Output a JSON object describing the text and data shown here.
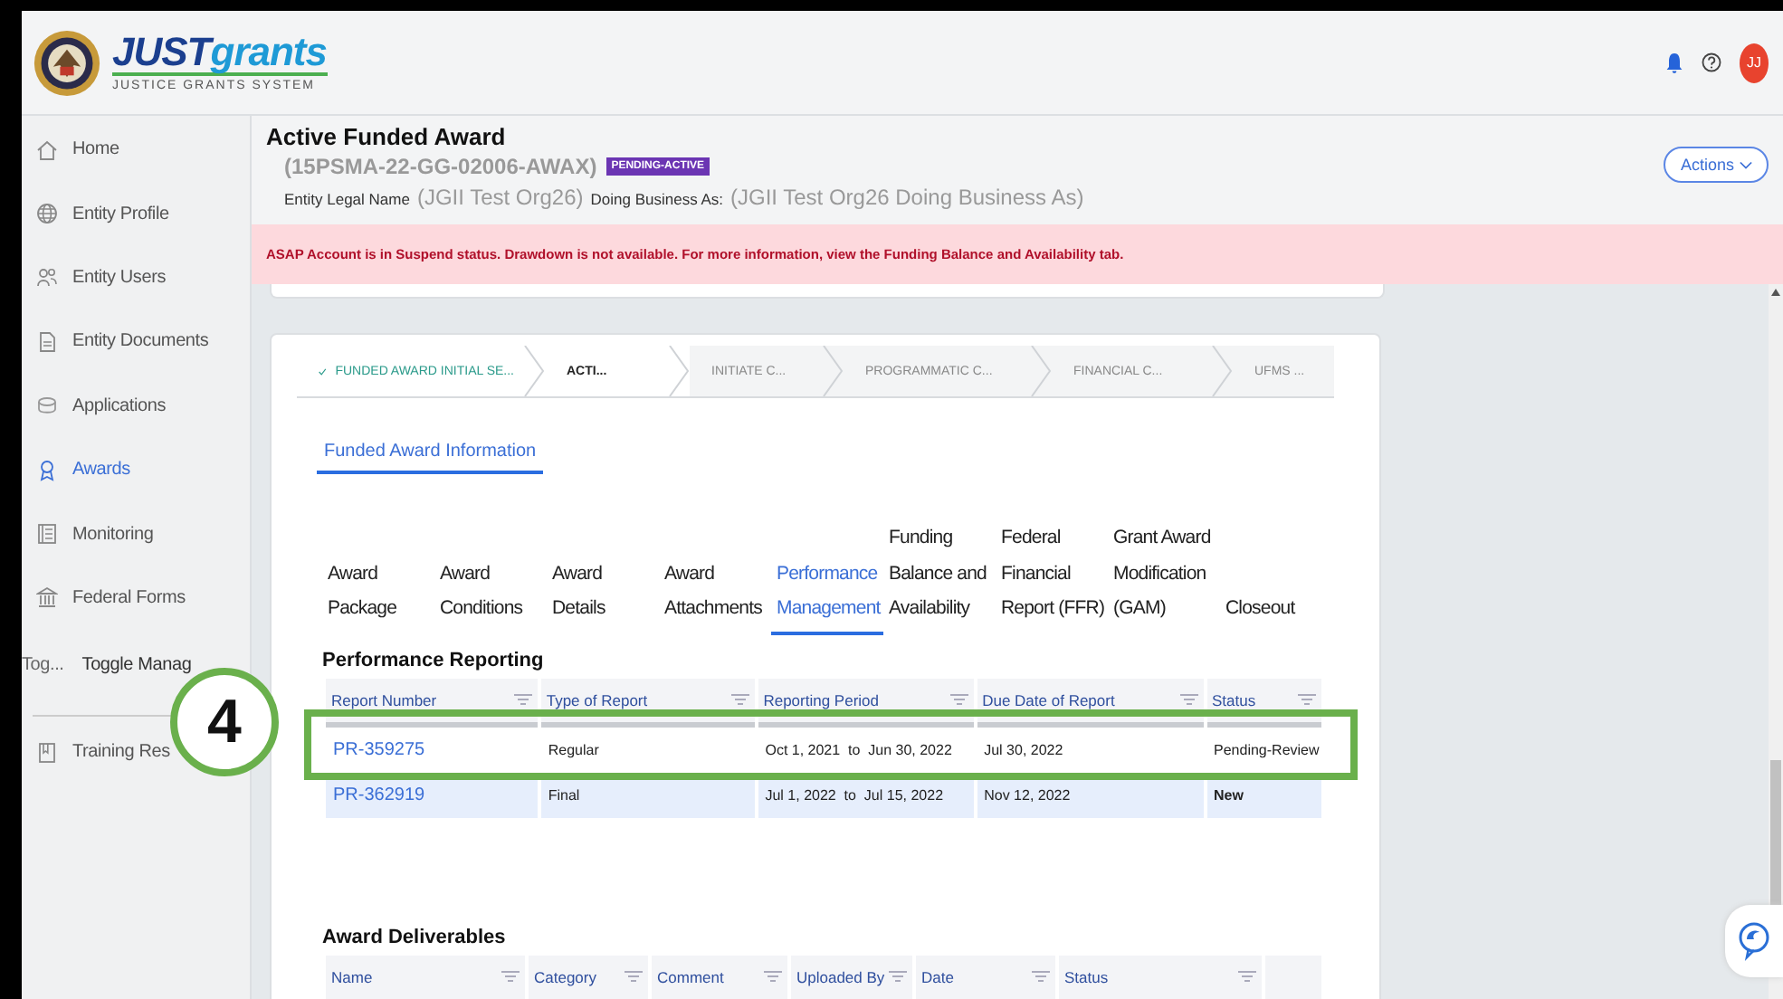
{
  "header": {
    "logo_primary": "JUST",
    "logo_secondary": "grants",
    "tagline": "JUSTICE GRANTS SYSTEM",
    "avatar": "JJ"
  },
  "sidebar": {
    "items": [
      {
        "kind": "link",
        "label": "Home",
        "selected": false
      },
      {
        "kind": "link",
        "label": "Entity Profile",
        "selected": false
      },
      {
        "kind": "link",
        "label": "Entity Users",
        "selected": false
      },
      {
        "kind": "link",
        "label": "Entity Documents",
        "selected": false
      },
      {
        "kind": "link",
        "label": "Applications",
        "selected": false
      },
      {
        "kind": "link",
        "label": "Awards",
        "selected": true
      },
      {
        "kind": "link",
        "label": "Monitoring",
        "selected": false
      },
      {
        "kind": "link",
        "label": "Federal Forms",
        "selected": false
      },
      {
        "kind": "toggle",
        "prefix": "Tog...",
        "label": "Toggle Manag"
      },
      {
        "kind": "divider"
      },
      {
        "kind": "link",
        "label": "Training Res",
        "selected": false
      }
    ]
  },
  "page_header": {
    "title": "Active Funded Award",
    "award_id": "(15PSMA-22-GG-02006-AWAX)",
    "status_badge": "PENDING-ACTIVE",
    "legal_name_label": "Entity Legal Name",
    "legal_name": "(JGII Test Org26)",
    "dba_label": "Doing Business As:",
    "dba": "(JGII Test Org26 Doing Business As)",
    "actions_button": "Actions"
  },
  "alert": {
    "text": "ASAP Account is in Suspend status. Drawdown is not available. For more information, view the Funding Balance and Availability tab."
  },
  "stepper": [
    {
      "label": "FUNDED AWARD INITIAL SE...",
      "completed": true,
      "selected": false
    },
    {
      "label": "ACTI...",
      "completed": false,
      "selected": true
    },
    {
      "label": "INITIATE C...",
      "completed": false,
      "selected": false
    },
    {
      "label": "PROGRAMMATIC C...",
      "completed": false,
      "selected": false
    },
    {
      "label": "FINANCIAL C...",
      "completed": false,
      "selected": false
    },
    {
      "label": "UFMS ...",
      "completed": false,
      "selected": false
    }
  ],
  "section_tabs": [
    {
      "label": "Funded Award Information",
      "selected": true
    }
  ],
  "tabs": [
    {
      "label": "Award Package",
      "selected": false
    },
    {
      "label": "Award Conditions",
      "selected": false
    },
    {
      "label": "Award Details",
      "selected": false
    },
    {
      "label": "Award Attachments",
      "selected": false
    },
    {
      "label": "Performance Management",
      "selected": true
    },
    {
      "label": "Funding Balance and Availability",
      "selected": false
    },
    {
      "label": "Federal Financial Report (FFR)",
      "selected": false
    },
    {
      "label": "Grant Award Modification (GAM)",
      "selected": false
    },
    {
      "label": "Closeout",
      "selected": false
    }
  ],
  "performance_reporting": {
    "title": "Performance Reporting",
    "columns": [
      "Report Number",
      "Type of Report",
      "Reporting Period",
      "Due Date of Report",
      "Status"
    ],
    "rows": [
      {
        "selected": false,
        "report_number": "PR-359275",
        "type": "Regular",
        "period": "Oct 1, 2021  to  Jun 30, 2022",
        "due_date": "Jul 30, 2022",
        "status": "Pending-Review",
        "status_emphasized": false
      },
      {
        "selected": true,
        "report_number": "PR-362919",
        "type": "Final",
        "period": "Jul 1, 2022  to  Jul 15, 2022",
        "due_date": "Nov 12, 2022",
        "status": "New",
        "status_emphasized": true
      }
    ]
  },
  "award_deliverables": {
    "title": "Award Deliverables",
    "columns": [
      "Name",
      "Category",
      "Comment",
      "Uploaded By",
      "Date",
      "Status"
    ]
  },
  "annotation": {
    "step_number": "4"
  }
}
